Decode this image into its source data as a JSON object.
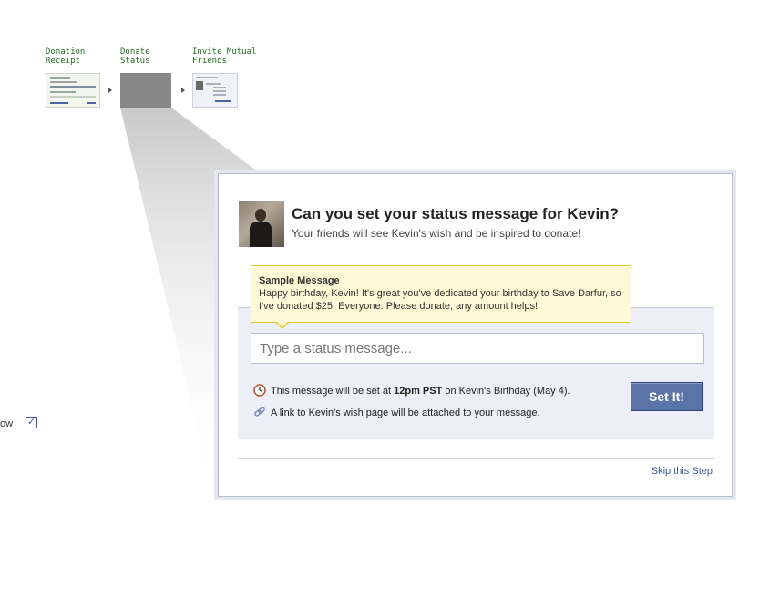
{
  "flow": {
    "steps": [
      {
        "label": "Donation\nReceipt"
      },
      {
        "label": "Donate\nStatus"
      },
      {
        "label": "Invite Mutual\nFriends"
      }
    ],
    "active_step": 1
  },
  "left_cut": {
    "text": "ow",
    "checked": true
  },
  "dialog": {
    "title": "Can you set your status message for Kevin?",
    "subtitle": "Your friends will see Kevin's wish and be inspired to donate!",
    "sample": {
      "heading": "Sample Message",
      "body": "Happy birthday, Kevin! It's great you've dedicated your birthday to Save Darfur, so I've donated $25. Everyone: Please donate, any amount helps!"
    },
    "status_input": {
      "placeholder": "Type a status message...",
      "value": ""
    },
    "schedule": {
      "prefix": "This message will be set at ",
      "time": "12pm PST",
      "suffix": " on Kevin's Birthday (May 4).",
      "icon": "clock-icon"
    },
    "link_note": {
      "text": "A link to Kevin's wish page will be attached to your message.",
      "icon": "link-icon"
    },
    "set_button": "Set It!",
    "skip_link": "Skip this Step"
  },
  "colors": {
    "button": "#5b74a8",
    "link": "#3b5998",
    "sample_bg": "#fff9d7",
    "step_label": "#1e6a1e"
  }
}
